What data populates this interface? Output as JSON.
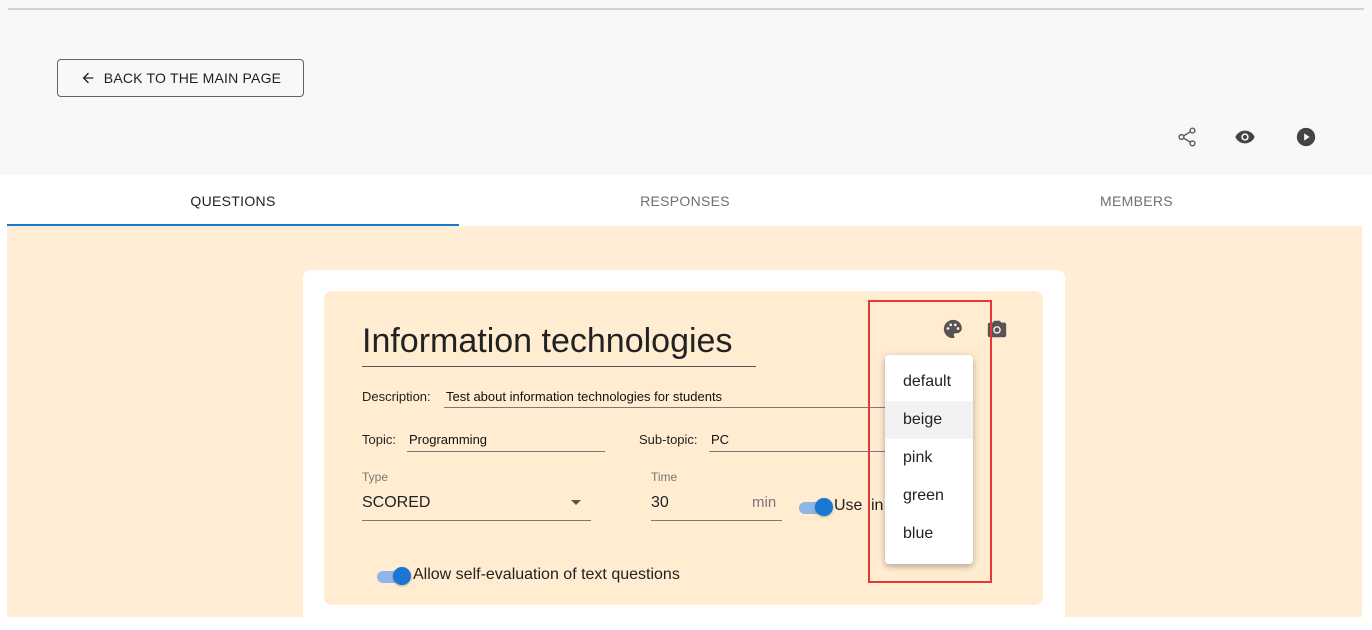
{
  "header": {
    "back_label": "BACK TO THE MAIN PAGE",
    "icons": [
      "share-icon",
      "eye-icon",
      "play-icon"
    ]
  },
  "tabs": [
    {
      "label": "QUESTIONS",
      "active": true
    },
    {
      "label": "RESPONSES",
      "active": false
    },
    {
      "label": "MEMBERS",
      "active": false
    }
  ],
  "form": {
    "title": "Information technologies",
    "description_label": "Description:",
    "description_value": "Test about information technologies for students",
    "topic_label": "Topic:",
    "topic_value": "Programming",
    "subtopic_label": "Sub-topic:",
    "subtopic_value": "PC",
    "type_label": "Type",
    "type_value": "SCORED",
    "time_label": "Time",
    "time_value": "30",
    "time_unit": "min",
    "use_switch_label": "Use",
    "use_switch_label_cut": "in",
    "self_eval_label": "Allow self-evaluation of text questions"
  },
  "color_menu": {
    "items": [
      "default",
      "beige",
      "pink",
      "green",
      "blue"
    ],
    "hovered": "beige"
  },
  "colors": {
    "accent": "#1976d2",
    "card_background": "#ffecd1",
    "page_background": "#ffedd5",
    "highlight": "#e53935"
  }
}
